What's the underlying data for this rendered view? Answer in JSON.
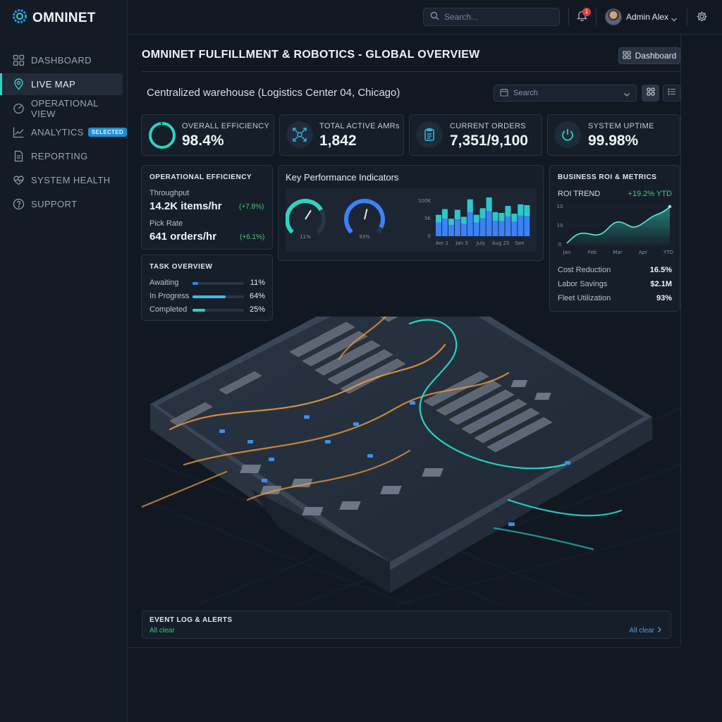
{
  "app": {
    "name": "OMNINET"
  },
  "sidebar": {
    "items": [
      {
        "label": "DASHBOARD",
        "icon": "grid-icon"
      },
      {
        "label": "LIVE MAP",
        "icon": "map-pin-icon",
        "active": true
      },
      {
        "label": "OPERATIONAL VIEW",
        "icon": "gauge-icon"
      },
      {
        "label": "ANALYTICS",
        "icon": "line-chart-icon",
        "badge": "SELECTED"
      },
      {
        "label": "REPORTING",
        "icon": "document-icon"
      },
      {
        "label": "SYSTEM HEALTH",
        "icon": "heart-pulse-icon"
      },
      {
        "label": "SUPPORT",
        "icon": "help-circle-icon"
      }
    ]
  },
  "topbar": {
    "search_placeholder": "Search...",
    "notification_count": "1",
    "user_name": "Admin Alex"
  },
  "header": {
    "title": "OMNINET FULFILLMENT & ROBOTICS - GLOBAL OVERVIEW",
    "dashboard_button": "Dashboard",
    "subtitle": "Centralized warehouse (Logistics Center 04, Chicago)",
    "search_placeholder": "Search"
  },
  "kpis": [
    {
      "label": "OVERALL EFFICIENCY",
      "value": "98.4%",
      "icon": "ring-icon"
    },
    {
      "label": "TOTAL ACTIVE AMRs",
      "value": "1,842",
      "icon": "robot-arms-icon"
    },
    {
      "label": "CURRENT ORDERS",
      "value": "7,351/9,100",
      "icon": "clipboard-icon"
    },
    {
      "label": "SYSTEM UPTIME",
      "value": "99.98%",
      "icon": "power-icon"
    }
  ],
  "operational": {
    "title": "OPERATIONAL EFFICIENCY",
    "throughput_label": "Throughput",
    "throughput_value": "14.2K items/hr",
    "throughput_change": "(+7.8%)",
    "pick_label": "Pick Rate",
    "pick_value": "641 orders/hr",
    "pick_change": "(+6.1%)"
  },
  "tasks": {
    "title": "TASK OVERVIEW",
    "rows": [
      {
        "label": "Awaiting",
        "pct": "11%",
        "fraction": 0.11,
        "color": "#3b82f6"
      },
      {
        "label": "In Progress",
        "pct": "64%",
        "fraction": 0.64,
        "color": "#38bdf8"
      },
      {
        "label": "Completed",
        "pct": "25%",
        "fraction": 0.25,
        "color": "#2dd4bf"
      }
    ]
  },
  "kpi_panel": {
    "title": "Key Performance Indicators",
    "gauges": [
      {
        "label": "11%",
        "value": 0.11,
        "color": "#2dd4bf"
      },
      {
        "label": "93%",
        "value": 0.93,
        "color": "#3b82f6"
      }
    ],
    "y_ticks": [
      "100K",
      "5K",
      "0"
    ],
    "x_ticks": [
      "Aor 1",
      "Jan 3",
      "July",
      "Aug 25",
      "Sen"
    ],
    "colors": {
      "bar_top": "#2dd4bf",
      "bar_bottom": "#3b82f6"
    }
  },
  "roi": {
    "title": "BUSINESS ROI & METRICS",
    "trend_label": "ROI TREND",
    "trend_value": "+19.2% YTD",
    "y_ticks": [
      "10",
      "10",
      "0"
    ],
    "x_ticks": [
      "Jan",
      "Feb",
      "Mar",
      "Apr",
      "YTD"
    ],
    "metrics": [
      {
        "label": "Cost Reduction",
        "value": "16.5%"
      },
      {
        "label": "Labor Savings",
        "value": "$2.1M"
      },
      {
        "label": "Fleet Utilization",
        "value": "93%"
      }
    ]
  },
  "events": {
    "title": "EVENT LOG & ALERTS",
    "status": "All clear",
    "link": "All clear"
  },
  "colors": {
    "accent": "#2fd3c6",
    "positive": "#46c47a",
    "link": "#4d9fe0",
    "alert": "#e03a3a"
  }
}
